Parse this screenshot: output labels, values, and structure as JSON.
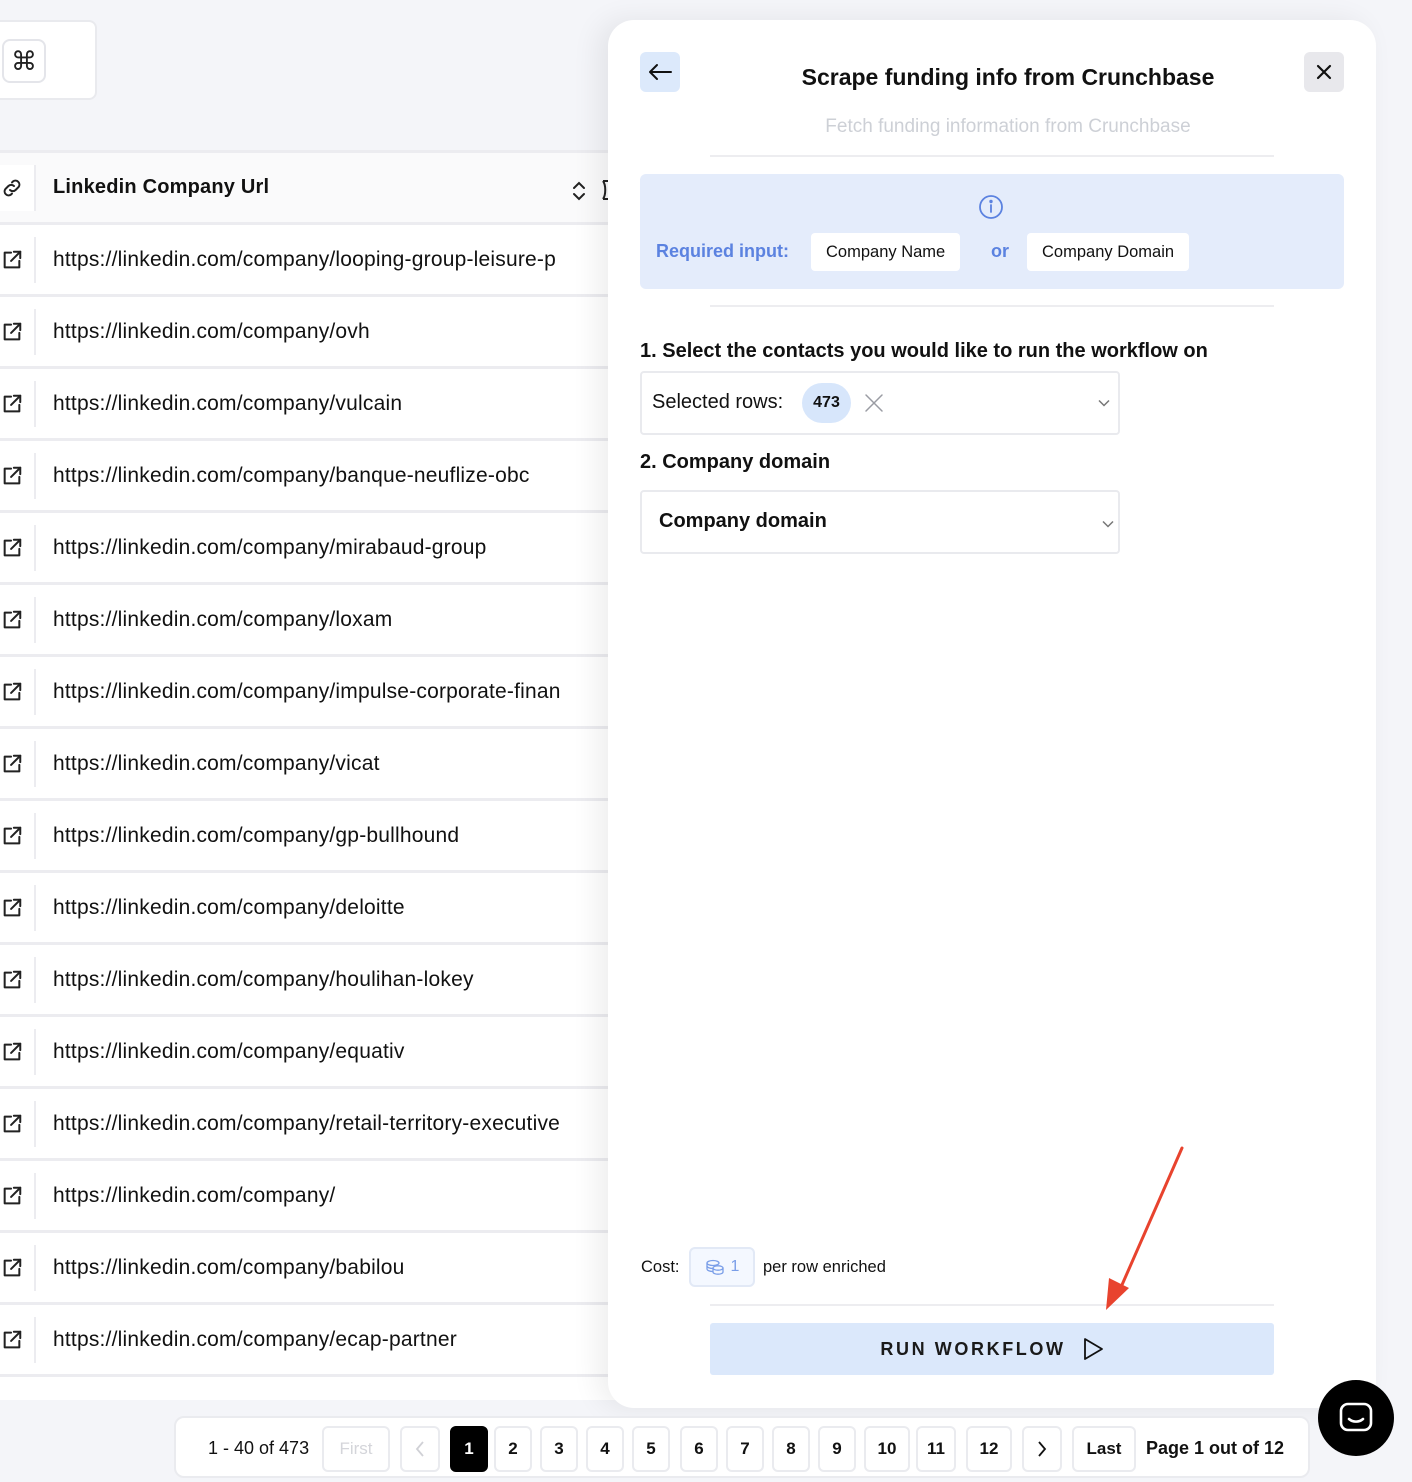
{
  "shortcut": {
    "key_glyph": "⌘"
  },
  "table": {
    "column_header": "Linkedin Company Url",
    "rows": [
      "https://linkedin.com/company/looping-group-leisure-p",
      "https://linkedin.com/company/ovh",
      "https://linkedin.com/company/vulcain",
      "https://linkedin.com/company/banque-neuflize-obc",
      "https://linkedin.com/company/mirabaud-group",
      "https://linkedin.com/company/loxam",
      "https://linkedin.com/company/impulse-corporate-finan",
      "https://linkedin.com/company/vicat",
      "https://linkedin.com/company/gp-bullhound",
      "https://linkedin.com/company/deloitte",
      "https://linkedin.com/company/houlihan-lokey",
      "https://linkedin.com/company/equativ",
      "https://linkedin.com/company/retail-territory-executive",
      "https://linkedin.com/company/",
      "https://linkedin.com/company/babilou",
      "https://linkedin.com/company/ecap-partner"
    ]
  },
  "panel": {
    "title": "Scrape funding info from Crunchbase",
    "subtitle": "Fetch funding information from Crunchbase",
    "required": {
      "label": "Required input:",
      "option_a": "Company Name",
      "or": "or",
      "option_b": "Company Domain"
    },
    "step1": {
      "label": "1. Select the contacts you would like to run the workflow on",
      "select_label": "Selected rows:",
      "count": "473"
    },
    "step2": {
      "label": "2. Company domain",
      "value": "Company domain"
    },
    "cost": {
      "label": "Cost:",
      "amount": "1",
      "suffix": "per row enriched"
    },
    "run_button": "RUN WORKFLOW"
  },
  "pagination": {
    "range": "1 - 40 of 473",
    "first": "First",
    "last": "Last",
    "pages": [
      "1",
      "2",
      "3",
      "4",
      "5",
      "6",
      "7",
      "8",
      "9",
      "10",
      "11",
      "12"
    ],
    "current": "1",
    "info": "Page 1 out of 12"
  },
  "colors": {
    "accent_blue": "#5b82e0",
    "required_bg": "#e4ecfb",
    "run_button_bg": "#dbe8fb",
    "annotation_arrow": "#e8432e"
  },
  "icons": {
    "header": "link-icon",
    "rows": "external-link-icon",
    "back": "arrow-left-icon",
    "close": "close-icon",
    "info": "info-icon",
    "clear": "x-icon",
    "dropdown": "chevron-down-icon",
    "credits": "coins-icon",
    "run": "play-icon",
    "chat": "chat-icon"
  }
}
